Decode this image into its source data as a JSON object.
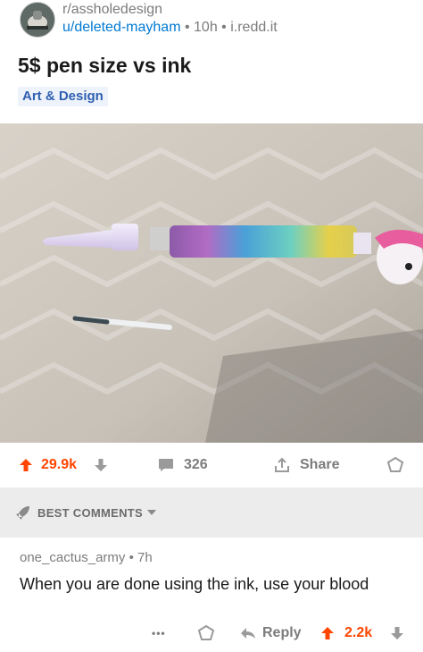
{
  "post": {
    "subreddit": "r/assholedesign",
    "author": "u/deleted-mayham",
    "time": "10h",
    "domain": "i.redd.it",
    "title": "5$ pen size vs ink",
    "flair": "Art & Design",
    "score": "29.9k",
    "comments": "326",
    "share_label": "Share"
  },
  "comments_header": {
    "label": "BEST COMMENTS"
  },
  "comment": {
    "author": "one_cactus_army",
    "time": "7h",
    "body": "When you are done using the ink, use your blood",
    "more": "•••",
    "reply_label": "Reply",
    "score": "2.2k"
  },
  "colors": {
    "upvote": "#ff4500",
    "link": "#0079d3",
    "muted": "#7c7c7c",
    "flair_bg": "#eef3fb"
  },
  "icons": [
    "subreddit-avatar",
    "upvote-arrow",
    "downvote-arrow",
    "comment-bubble",
    "share-icon",
    "award-icon",
    "rocket-icon",
    "caret-down",
    "more-dots",
    "reply-arrow"
  ]
}
